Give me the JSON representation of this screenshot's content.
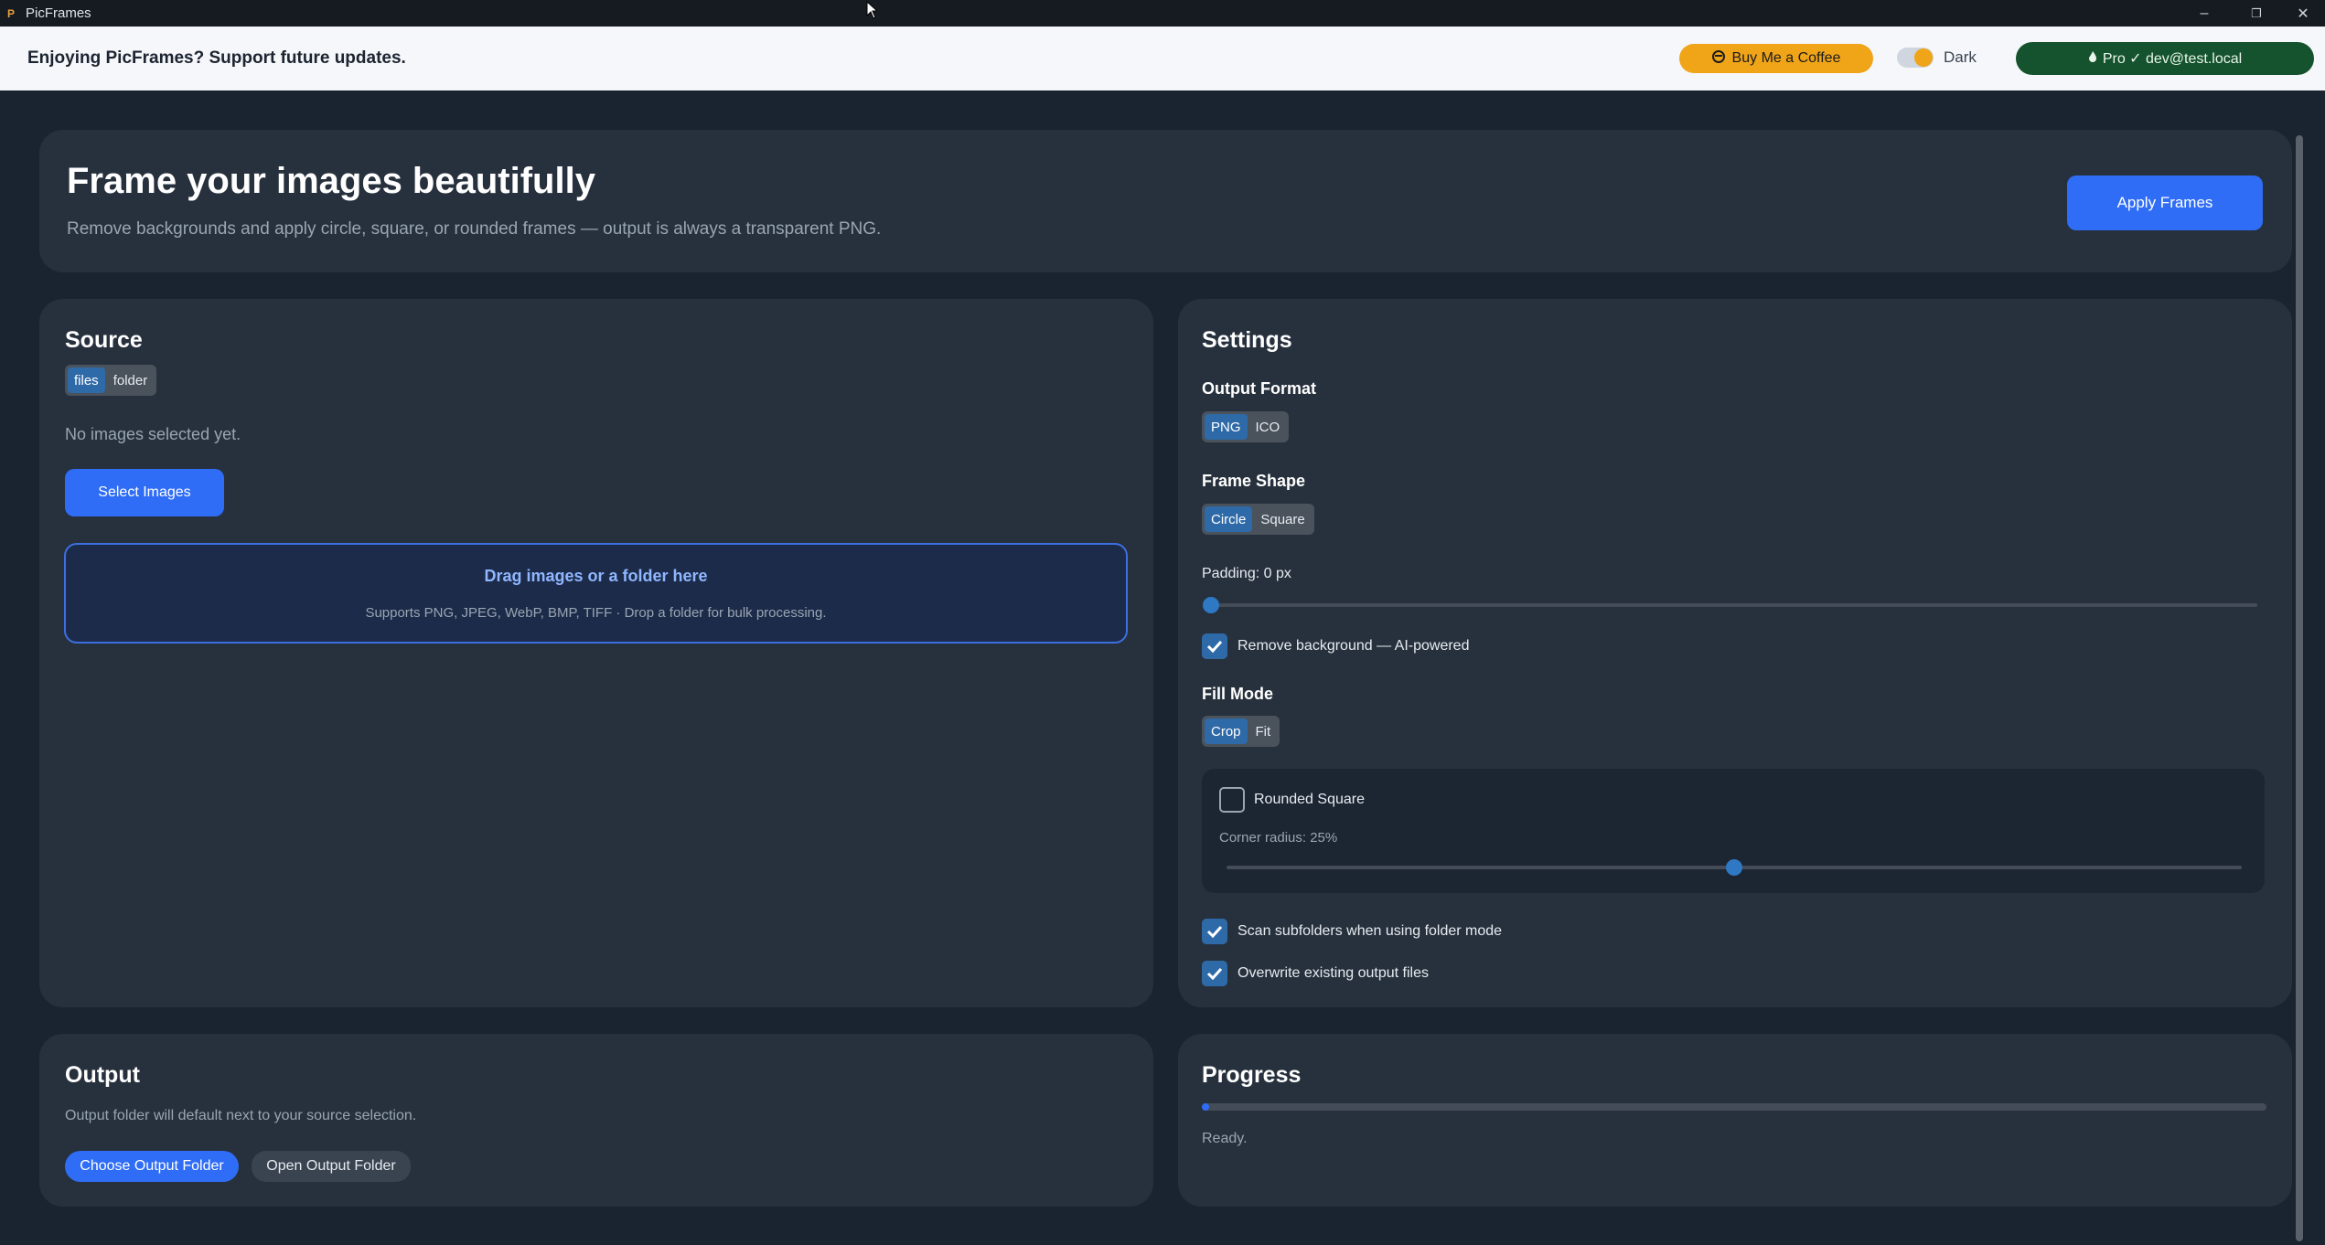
{
  "window": {
    "title": "PicFrames",
    "minimize": "–",
    "restore": "❐",
    "close": "✕"
  },
  "banner": {
    "message": "Enjoying PicFrames? Support future updates.",
    "coffee_icon": "coffee-icon",
    "coffee_label": "Buy Me a Coffee",
    "theme_toggle_on": true,
    "theme_label": "Dark",
    "pro_icon": "flame-icon",
    "pro_label": "Pro ✓ dev@test.local"
  },
  "hero": {
    "title": "Frame your images beautifully",
    "subtitle": "Remove backgrounds and apply circle, square, or rounded frames — output is always a transparent PNG.",
    "apply_label": "Apply Frames"
  },
  "source": {
    "title": "Source",
    "modes": [
      "files",
      "folder"
    ],
    "active_mode": "files",
    "empty_text": "No images selected yet.",
    "select_label": "Select Images",
    "drop_title": "Drag images or a folder here",
    "drop_sub": "Supports PNG, JPEG, WebP, BMP, TIFF · Drop a folder for bulk processing."
  },
  "settings": {
    "title": "Settings",
    "output_format_label": "Output Format",
    "output_formats": [
      "PNG",
      "ICO"
    ],
    "output_format_active": "PNG",
    "frame_shape_label": "Frame Shape",
    "frame_shapes": [
      "Circle",
      "Square"
    ],
    "frame_shape_active": "Circle",
    "padding_label": "Padding: 0 px",
    "padding_value": 0,
    "remove_bg_checked": true,
    "remove_bg_label": "Remove background — AI-powered",
    "fill_mode_label": "Fill Mode",
    "fill_modes": [
      "Crop",
      "Fit"
    ],
    "fill_mode_active": "Crop",
    "rounded_square_checked": false,
    "rounded_square_label": "Rounded Square",
    "corner_radius_label": "Corner radius: 25%",
    "corner_radius_value": 25,
    "scan_subfolders_checked": true,
    "scan_subfolders_label": "Scan subfolders when using folder mode",
    "overwrite_checked": true,
    "overwrite_label": "Overwrite existing output files"
  },
  "output": {
    "title": "Output",
    "info": "Output folder will default next to your source selection.",
    "choose_label": "Choose Output Folder",
    "open_label": "Open Output Folder"
  },
  "progress": {
    "title": "Progress",
    "percent": 0,
    "status": "Ready."
  },
  "colors": {
    "accent": "#2f6df6",
    "coffee": "#f0a418",
    "pro": "#14532d",
    "background": "#1a2430",
    "card": "#27313d"
  }
}
